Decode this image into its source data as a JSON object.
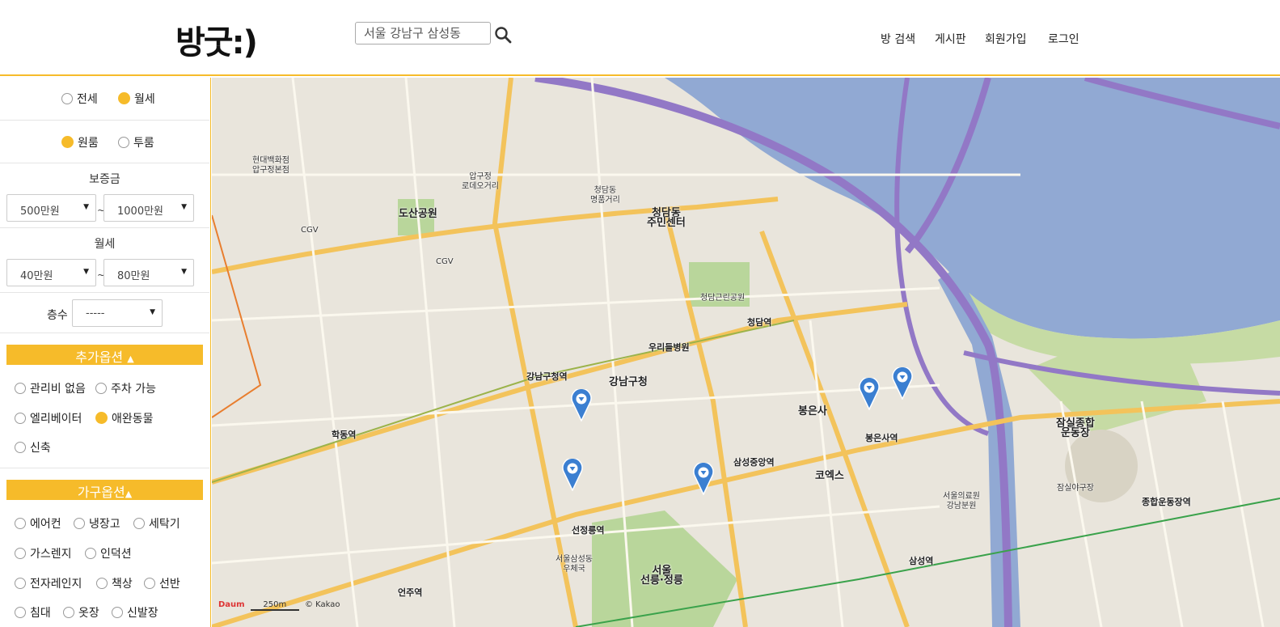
{
  "header": {
    "logo": "방굿:)",
    "search_value": "서울 강남구 삼성동",
    "nav": [
      "방 검색",
      "게시판",
      "회원가입",
      "로그인"
    ]
  },
  "sidebar": {
    "deal_type": [
      {
        "label": "전세",
        "checked": false
      },
      {
        "label": "월세",
        "checked": true
      }
    ],
    "room_type": [
      {
        "label": "원룸",
        "checked": true
      },
      {
        "label": "투룸",
        "checked": false
      }
    ],
    "deposit": {
      "title": "보증금",
      "min": "500만원",
      "max": "1000만원",
      "tilde": "~"
    },
    "monthly": {
      "title": "월세",
      "min": "40만원",
      "max": "80만원",
      "tilde": "~"
    },
    "floor": {
      "label": "층수",
      "value": "-----"
    },
    "extra": {
      "title": "추가옵션",
      "arrow": "▲",
      "items": [
        {
          "label": "관리비 없음",
          "checked": false
        },
        {
          "label": "주차 가능",
          "checked": false
        },
        {
          "label": "엘리베이터",
          "checked": false
        },
        {
          "label": "애완동물",
          "checked": true
        },
        {
          "label": "신축",
          "checked": false
        }
      ]
    },
    "furniture": {
      "title": "가구옵션",
      "arrow": "▲",
      "items": [
        {
          "label": "에어컨",
          "checked": false
        },
        {
          "label": "냉장고",
          "checked": false
        },
        {
          "label": "세탁기",
          "checked": false
        },
        {
          "label": "가스렌지",
          "checked": false
        },
        {
          "label": "인덕션",
          "checked": false
        },
        {
          "label": "전자레인지",
          "checked": false
        },
        {
          "label": "책상",
          "checked": false
        },
        {
          "label": "선반",
          "checked": false
        },
        {
          "label": "침대",
          "checked": false
        },
        {
          "label": "옷장",
          "checked": false
        },
        {
          "label": "신발장",
          "checked": false
        }
      ]
    }
  },
  "map": {
    "labels": {
      "hyundai_dept": "현대백화점\n압구정본점",
      "dosan_park": "도산공원",
      "cgv1": "CGV",
      "cgv2": "CGV",
      "apgujeong_rodeo": "압구정\n로데오거리",
      "cheongdam_luxury": "청담동\n명품거리",
      "cheongdam_center": "청담동\n주민센터",
      "cheongdam_park": "청담근린공원",
      "cheongdam_station": "청담역",
      "gangnam_gucheong_station": "강남구청역",
      "gangnam_gucheong": "강남구청",
      "woori_hospital": "우리들병원",
      "bongeunsa": "봉은사",
      "coex": "코엑스",
      "bongeunsa_station": "봉은사역",
      "samseong_jungang_station": "삼성중앙역",
      "seonjeongneung_station": "선정릉역",
      "seolleung_tombs": "서울\n선릉·정릉",
      "samseong_post": "서울삼성동\n우체국",
      "sports_complex": "잠실종합\n운동장",
      "sports_complex_station": "종합운동장역",
      "samseong_station": "삼성역",
      "jamsil_baseball": "잠실야구장",
      "seoul_medical": "서울의료원\n강남분원",
      "hakdong_station": "학동역",
      "eonju_station": "언주역",
      "kakao": "© Kakao",
      "scale": "250m",
      "daum": "Daum"
    },
    "pins_count": 5
  },
  "colors": {
    "accent": "#f6bb2a",
    "road_major": "#f3c35b",
    "highway": "#9278c6",
    "river": "#91a9d3"
  }
}
